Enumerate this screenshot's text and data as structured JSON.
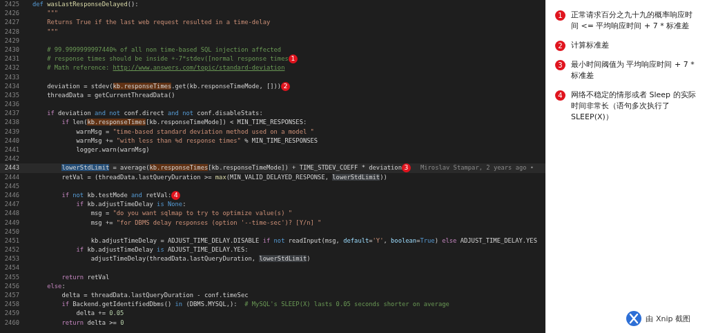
{
  "editor": {
    "lines": [
      {
        "number": "2425",
        "current": false,
        "tokens": [
          {
            "kind": "keyword",
            "text": "def "
          },
          {
            "kind": "function",
            "text": "wasLastResponseDelayed"
          },
          {
            "kind": "plain",
            "text": "():"
          }
        ]
      },
      {
        "number": "2426",
        "current": false,
        "tokens": [
          {
            "kind": "string",
            "text": "    \"\"\""
          }
        ]
      },
      {
        "number": "2427",
        "current": false,
        "tokens": [
          {
            "kind": "string",
            "text": "    Returns True if the last web request resulted in a time-delay"
          }
        ]
      },
      {
        "number": "2428",
        "current": false,
        "tokens": [
          {
            "kind": "string",
            "text": "    \"\"\""
          }
        ]
      },
      {
        "number": "2429",
        "current": false
      },
      {
        "number": "2430",
        "current": false,
        "tokens": [
          {
            "kind": "comment",
            "text": "    # 99.9999999997440% of all non time-based SQL injection affected"
          }
        ]
      },
      {
        "number": "2431",
        "current": false,
        "tokens": [
          {
            "kind": "comment",
            "text": "    # response times should be inside +-7*stdev([normal response times"
          },
          {
            "kind": "marker",
            "text": "1"
          }
        ]
      },
      {
        "number": "2432",
        "current": false,
        "tokens": [
          {
            "kind": "comment",
            "text": "    # Math reference: "
          },
          {
            "kind": "link",
            "text": "http://www.answers.com/topic/standard-deviation"
          }
        ]
      },
      {
        "number": "2433",
        "current": false
      },
      {
        "number": "2434",
        "current": false,
        "tokens": [
          {
            "kind": "plain",
            "text": "    deviation = stdev("
          },
          {
            "kind": "read",
            "text": "kb.responseTimes"
          },
          {
            "kind": "plain",
            "text": ".get(kb.responseTimeMode, []))"
          },
          {
            "kind": "marker",
            "text": "2"
          }
        ]
      },
      {
        "number": "2435",
        "current": false,
        "tokens": [
          {
            "kind": "plain",
            "text": "    threadData = getCurrentThreadData()"
          }
        ]
      },
      {
        "number": "2436",
        "current": false
      },
      {
        "number": "2437",
        "current": false,
        "tokens": [
          {
            "kind": "control",
            "text": "    if"
          },
          {
            "kind": "plain",
            "text": " deviation "
          },
          {
            "kind": "keyword",
            "text": "and not"
          },
          {
            "kind": "plain",
            "text": " conf.direct "
          },
          {
            "kind": "keyword",
            "text": "and not"
          },
          {
            "kind": "plain",
            "text": " conf.disableStats:"
          }
        ]
      },
      {
        "number": "2438",
        "current": false,
        "tokens": [
          {
            "kind": "control",
            "text": "        if"
          },
          {
            "kind": "plain",
            "text": " len("
          },
          {
            "kind": "read",
            "text": "kb.responseTimes"
          },
          {
            "kind": "plain",
            "text": "[kb.responseTimeMode]) < MIN_TIME_RESPONSES:"
          }
        ]
      },
      {
        "number": "2439",
        "current": false,
        "tokens": [
          {
            "kind": "plain",
            "text": "            warnMsg = "
          },
          {
            "kind": "string",
            "text": "\"time-based standard deviation method used on a model \""
          }
        ]
      },
      {
        "number": "2440",
        "current": false,
        "tokens": [
          {
            "kind": "plain",
            "text": "            warnMsg += "
          },
          {
            "kind": "string",
            "text": "\"with less than %d response times\""
          },
          {
            "kind": "plain",
            "text": " % MIN_TIME_RESPONSES"
          }
        ]
      },
      {
        "number": "2441",
        "current": false,
        "tokens": [
          {
            "kind": "plain",
            "text": "            logger.warn(warnMsg)"
          }
        ]
      },
      {
        "number": "2442",
        "current": false
      },
      {
        "number": "2443",
        "current": true,
        "blame": "Miroslav Stampar, 2 years ago •",
        "tokens": [
          {
            "kind": "selection",
            "text": "        lowerStdLimit"
          },
          {
            "kind": "plain",
            "text": " = average("
          },
          {
            "kind": "read",
            "text": "kb.responseTimes"
          },
          {
            "kind": "plain",
            "text": "[kb.responseTimeMode]) + TIME_STDEV_COEFF * deviation"
          },
          {
            "kind": "marker",
            "text": "3"
          }
        ]
      },
      {
        "number": "2444",
        "current": false,
        "tokens": [
          {
            "kind": "plain",
            "text": "        retVal = (threadData.lastQueryDuration >= "
          },
          {
            "kind": "function",
            "text": "max"
          },
          {
            "kind": "plain",
            "text": "(MIN_VALID_DELAYED_RESPONSE, "
          },
          {
            "kind": "occurrence",
            "text": "lowerStdLimit"
          },
          {
            "kind": "plain",
            "text": "))"
          }
        ]
      },
      {
        "number": "2445",
        "current": false
      },
      {
        "number": "2446",
        "current": false,
        "tokens": [
          {
            "kind": "control",
            "text": "        if "
          },
          {
            "kind": "keyword",
            "text": "not"
          },
          {
            "kind": "plain",
            "text": " kb.testMode "
          },
          {
            "kind": "keyword",
            "text": "and"
          },
          {
            "kind": "plain",
            "text": " retVal:"
          },
          {
            "kind": "marker",
            "text": "4"
          }
        ]
      },
      {
        "number": "2447",
        "current": false,
        "tokens": [
          {
            "kind": "control",
            "text": "            if"
          },
          {
            "kind": "plain",
            "text": " kb.adjustTimeDelay "
          },
          {
            "kind": "keyword",
            "text": "is None"
          },
          {
            "kind": "plain",
            "text": ":"
          }
        ]
      },
      {
        "number": "2448",
        "current": false,
        "tokens": [
          {
            "kind": "plain",
            "text": "                msg = "
          },
          {
            "kind": "string",
            "text": "\"do you want sqlmap to try to optimize value(s) \""
          }
        ]
      },
      {
        "number": "2449",
        "current": false,
        "tokens": [
          {
            "kind": "plain",
            "text": "                msg += "
          },
          {
            "kind": "string",
            "text": "\"for DBMS delay responses (option '--time-sec')? [Y/n] \""
          }
        ]
      },
      {
        "number": "2450",
        "current": false
      },
      {
        "number": "2451",
        "current": false,
        "tokens": [
          {
            "kind": "plain",
            "text": "                kb.adjustTimeDelay = ADJUST_TIME_DELAY.DISABLE "
          },
          {
            "kind": "control",
            "text": "if "
          },
          {
            "kind": "keyword",
            "text": "not"
          },
          {
            "kind": "plain",
            "text": " readInput(msg, "
          },
          {
            "kind": "parameter",
            "text": "default"
          },
          {
            "kind": "plain",
            "text": "="
          },
          {
            "kind": "string",
            "text": "'Y'"
          },
          {
            "kind": "plain",
            "text": ", "
          },
          {
            "kind": "parameter",
            "text": "boolean"
          },
          {
            "kind": "plain",
            "text": "="
          },
          {
            "kind": "keyword",
            "text": "True"
          },
          {
            "kind": "plain",
            "text": ") "
          },
          {
            "kind": "control",
            "text": "else"
          },
          {
            "kind": "plain",
            "text": " ADJUST_TIME_DELAY.YES"
          }
        ]
      },
      {
        "number": "2452",
        "current": false,
        "tokens": [
          {
            "kind": "control",
            "text": "            if"
          },
          {
            "kind": "plain",
            "text": " kb.adjustTimeDelay "
          },
          {
            "kind": "keyword",
            "text": "is"
          },
          {
            "kind": "plain",
            "text": " ADJUST_TIME_DELAY.YES:"
          }
        ]
      },
      {
        "number": "2453",
        "current": false,
        "tokens": [
          {
            "kind": "plain",
            "text": "                adjustTimeDelay(threadData.lastQueryDuration, "
          },
          {
            "kind": "occurrence",
            "text": "lowerStdLimit"
          },
          {
            "kind": "plain",
            "text": ")"
          }
        ]
      },
      {
        "number": "2454",
        "current": false
      },
      {
        "number": "2455",
        "current": false,
        "tokens": [
          {
            "kind": "control",
            "text": "        return"
          },
          {
            "kind": "plain",
            "text": " retVal"
          }
        ]
      },
      {
        "number": "2456",
        "current": false,
        "tokens": [
          {
            "kind": "control",
            "text": "    else"
          },
          {
            "kind": "plain",
            "text": ":"
          }
        ]
      },
      {
        "number": "2457",
        "current": false,
        "tokens": [
          {
            "kind": "plain",
            "text": "        delta = threadData.lastQueryDuration - conf.timeSec"
          }
        ]
      },
      {
        "number": "2458",
        "current": false,
        "tokens": [
          {
            "kind": "control",
            "text": "        if"
          },
          {
            "kind": "plain",
            "text": " Backend.getIdentifiedDbms() "
          },
          {
            "kind": "keyword",
            "text": "in"
          },
          {
            "kind": "plain",
            "text": " (DBMS.MYSQL,):  "
          },
          {
            "kind": "comment",
            "text": "# MySQL's SLEEP(X) lasts 0.05 seconds shorter on average"
          }
        ]
      },
      {
        "number": "2459",
        "current": false,
        "tokens": [
          {
            "kind": "plain",
            "text": "            delta += "
          },
          {
            "kind": "number",
            "text": "0.05"
          }
        ]
      },
      {
        "number": "2460",
        "current": false,
        "tokens": [
          {
            "kind": "control",
            "text": "        return"
          },
          {
            "kind": "plain",
            "text": " delta >= "
          },
          {
            "kind": "number",
            "text": "0"
          }
        ]
      }
    ]
  },
  "annotations": [
    {
      "marker": "1",
      "text": "正常请求百分之九十九的概率响应时间 <= 平均响应时间 + 7 * 标准差"
    },
    {
      "marker": "2",
      "text": "计算标准差"
    },
    {
      "marker": "3",
      "text": "最小时间阈值为 平均响应时间 + 7 * 标准差"
    },
    {
      "marker": "4",
      "text": "网络不稳定的情形或者 Sleep 的实际时间非常长（语句多次执行了 SLEEP(X)）"
    }
  ],
  "footer": {
    "text": "由 Xnip 截图"
  }
}
